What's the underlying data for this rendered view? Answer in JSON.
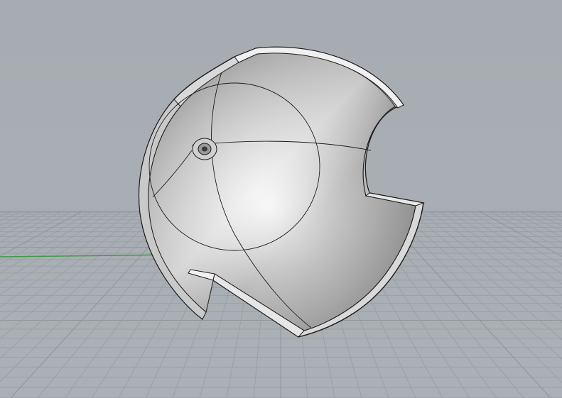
{
  "viewport": {
    "view_type": "perspective",
    "object": "spherical-shell-cutaway",
    "colors": {
      "background": "#a8adb3",
      "grid_line": "#9aa0a6",
      "grid_line_major": "#8f959b",
      "x_axis": "#c07a7a",
      "y_axis": "#3f9a4a",
      "shell_edge": "#1c1c1c",
      "shell_rim": "#e8e8e8"
    },
    "grid": {
      "visible": true,
      "axes_visible": true
    }
  }
}
